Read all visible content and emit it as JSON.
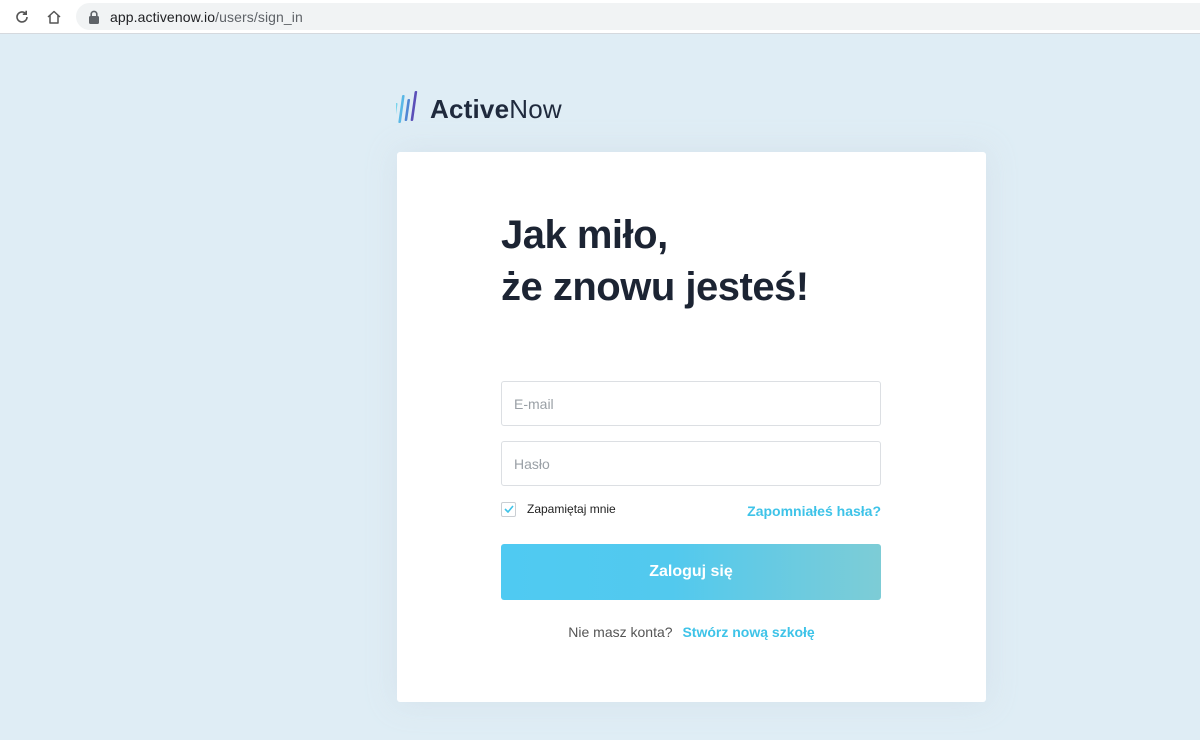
{
  "browser": {
    "url_host": "app.activenow.io",
    "url_path": "/users/sign_in"
  },
  "logo": {
    "text_bold": "Active",
    "text_light": "Now"
  },
  "heading": {
    "line1": "Jak miło,",
    "line2": "że znowu jesteś!"
  },
  "form": {
    "email_placeholder": "E-mail",
    "email_value": "",
    "password_placeholder": "Hasło",
    "password_value": "",
    "remember_label": "Zapamiętaj mnie",
    "remember_checked": true,
    "forgot_label": "Zapomniałeś hasła?",
    "submit_label": "Zaloguj się"
  },
  "signup": {
    "question": "Nie masz konta?",
    "link_label": "Stwórz nową szkołę"
  },
  "colors": {
    "accent": "#3ec3e8",
    "background": "#dfedf5",
    "heading": "#1c2433"
  }
}
